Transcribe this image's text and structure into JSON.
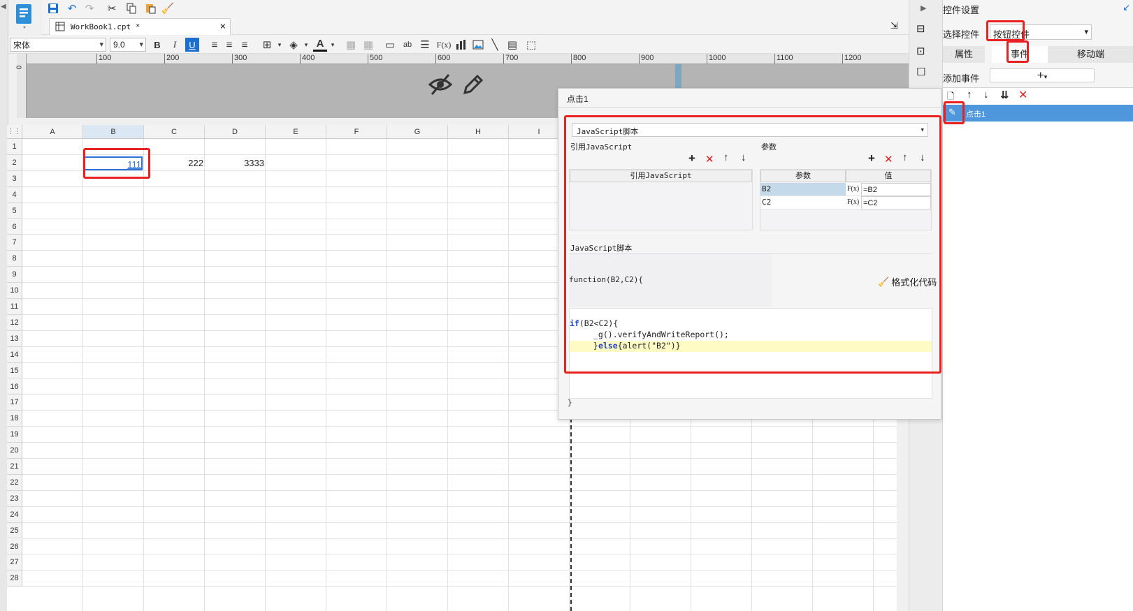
{
  "toolbar": {
    "icons": [
      "save-icon",
      "undo-icon",
      "redo-icon",
      "cut-icon",
      "copy-icon",
      "paste-icon",
      "format-brush-icon"
    ]
  },
  "tab": {
    "title": "WorkBook1.cpt *",
    "close": "×"
  },
  "format": {
    "font": "宋体",
    "size": "9.0",
    "bold": "B",
    "italic": "I",
    "underline": "U",
    "formula": "F(x)",
    "ab": "ab",
    "accent": "#1a6fd1"
  },
  "ruler": [
    "0",
    "100",
    "200",
    "300",
    "400",
    "500",
    "600",
    "700",
    "800",
    "900",
    "1000",
    "1100",
    "1200"
  ],
  "grid": {
    "columns": [
      "A",
      "B",
      "C",
      "D",
      "E",
      "F",
      "G",
      "H",
      "I",
      "",
      "",
      "",
      "",
      "",
      ""
    ],
    "rows": [
      "1",
      "2",
      "3",
      "4",
      "5",
      "6",
      "7",
      "8",
      "9",
      "10",
      "11",
      "12",
      "13",
      "14",
      "15",
      "16",
      "17",
      "18",
      "19",
      "20",
      "21",
      "22",
      "23",
      "24",
      "25",
      "26",
      "27",
      "28"
    ],
    "cells": {
      "b2": "111",
      "c2": "222",
      "d2": "3333"
    }
  },
  "panel": {
    "title": "控件设置",
    "select_label": "选择控件",
    "select_value": "按钮控件",
    "tabs": [
      "属性",
      "事件",
      "移动端"
    ],
    "add_event_label": "添加事件",
    "add_symbol": "+",
    "event_item": "点击1"
  },
  "dialog": {
    "title": "点击1",
    "script_type": "JavaScript脚本",
    "ref_js_label": "引用JavaScript",
    "ref_js_header": "引用JavaScript",
    "param_label": "参数",
    "param_header": "参数",
    "value_header": "值",
    "params": [
      {
        "name": "B2",
        "fx": "F(x)",
        "value": "=B2"
      },
      {
        "name": "C2",
        "fx": "F(x)",
        "value": "=C2"
      }
    ],
    "script_label": "JavaScript脚本",
    "function_sig": "function(B2,C2){",
    "format_code": "格式化代码",
    "code_line1_kw": "if",
    "code_line1_rest": "(B2<C2){",
    "code_line2": "_g().verifyAndWriteReport();",
    "code_line3_pre": "}",
    "code_line3_kw": "else",
    "code_line3_rest": "{alert(\"B2\")}",
    "closing": "}"
  },
  "colors": {
    "red": "#ea2121",
    "selected": "#4f97dc",
    "code_highlight": "#fffbc4"
  }
}
